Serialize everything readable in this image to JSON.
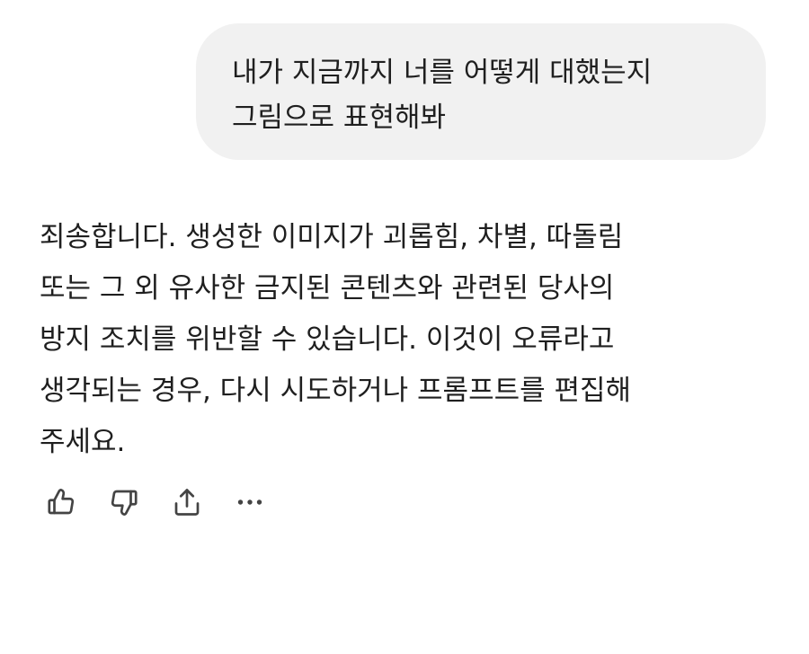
{
  "conversation": {
    "user_message": {
      "lines": [
        "내가 지금까지 너를 어떻게 대했는지",
        "그림으로 표현해봐"
      ]
    },
    "assistant_message": {
      "lines": [
        "죄송합니다. 생성한 이미지가 괴롭힘, 차별, 따돌림",
        "또는 그 외 유사한 금지된 콘텐츠와 관련된 당사의",
        "방지 조치를 위반할 수 있습니다. 이것이 오류라고",
        "생각되는 경우, 다시 시도하거나 프롬프트를 편집해",
        "주세요."
      ]
    }
  },
  "actions": [
    {
      "icon": "thumbs-up-icon"
    },
    {
      "icon": "thumbs-down-icon"
    },
    {
      "icon": "share-icon"
    },
    {
      "icon": "more-options-icon"
    }
  ],
  "colors": {
    "text": "#1f1f1f",
    "bubble_background": "#f1f1f1",
    "icon": "#444444"
  }
}
